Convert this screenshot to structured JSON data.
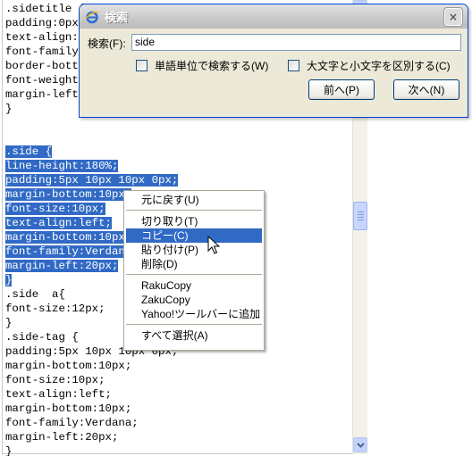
{
  "editor": {
    "lines": [
      ".sidetitle {",
      "padding:0px",
      "text-align:l",
      "font-family:",
      "border-botto",
      "font-weight:",
      "margin-left:",
      "}",
      "",
      "",
      ".side {",
      "line-height:180%;",
      "padding:5px 10px 10px 0px;",
      "margin-bottom:10px;",
      "font-size:10px;",
      "text-align:left;",
      "margin-bottom:10px;",
      "font-family:Verdana",
      "margin-left:20px;",
      "}",
      ".side  a{",
      "font-size:12px;",
      "}",
      ".side-tag {",
      "padding:5px 10px 10px 0px;",
      "margin-bottom:10px;",
      "font-size:10px;",
      "text-align:left;",
      "margin-bottom:10px;",
      "font-family:Verdana;",
      "margin-left:20px;",
      "}"
    ],
    "selected_from": 10,
    "selected_to": 19
  },
  "dialog": {
    "title": "検索",
    "close": "×",
    "search_label": "検索(F):",
    "search_value": "side",
    "option_whole_word": "単語単位で検索する(W)",
    "option_match_case": "大文字と小文字を区別する(C)",
    "prev_button": "前へ(P)",
    "next_button": "次へ(N)"
  },
  "context_menu": {
    "undo": "元に戻す(U)",
    "cut": "切り取り(T)",
    "copy": "コピー(C)",
    "paste": "貼り付け(P)",
    "delete": "削除(D)",
    "rakucopy": "RakuCopy",
    "zakucopy": "ZakuCopy",
    "yahoo_toolbar": "Yahoo!ツールバーに追加",
    "select_all": "すべて選択(A)"
  },
  "colors": {
    "selection": "#316ac5",
    "dialog_bg": "#ece9d8",
    "menu_border": "#aca899"
  }
}
